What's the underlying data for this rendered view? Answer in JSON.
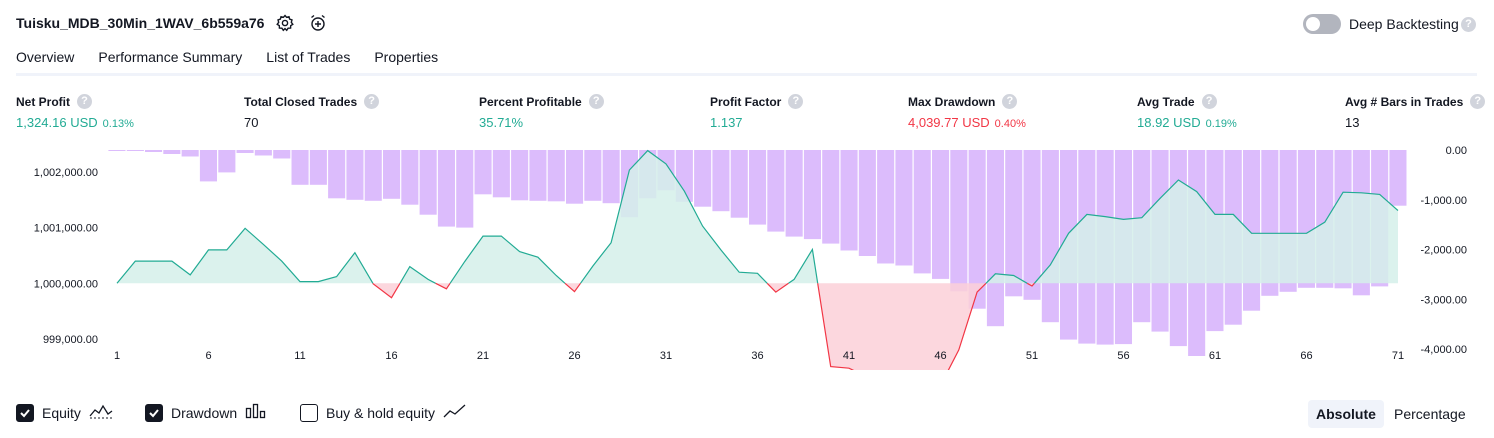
{
  "header": {
    "strategy_title": "Tuisku_MDB_30Min_1WAV_6b559a76",
    "settings_icon": "gear-icon",
    "add_alert_icon": "alarm-plus-icon",
    "deep_backtesting_label": "Deep Backtesting",
    "deep_backtesting_enabled": false,
    "help_glyph": "?"
  },
  "tabs": [
    {
      "label": "Overview",
      "active": true
    },
    {
      "label": "Performance Summary",
      "active": false
    },
    {
      "label": "List of Trades",
      "active": false
    },
    {
      "label": "Properties",
      "active": false
    }
  ],
  "metrics": [
    {
      "label": "Net Profit",
      "value": "1,324.16 USD",
      "pct": "0.13%",
      "color": "#22ab94"
    },
    {
      "label": "Total Closed Trades",
      "value": "70",
      "pct": "",
      "color": "#131722"
    },
    {
      "label": "Percent Profitable",
      "value": "35.71%",
      "pct": "",
      "color": "#22ab94"
    },
    {
      "label": "Profit Factor",
      "value": "1.137",
      "pct": "",
      "color": "#22ab94"
    },
    {
      "label": "Max Drawdown",
      "value": "4,039.77 USD",
      "pct": "0.40%",
      "color": "#f23645"
    },
    {
      "label": "Avg Trade",
      "value": "18.92 USD",
      "pct": "0.19%",
      "color": "#22ab94"
    },
    {
      "label": "Avg # Bars in Trades",
      "value": "13",
      "pct": "",
      "color": "#131722"
    }
  ],
  "chart_data": {
    "type": "line",
    "x_ticks": [
      "1",
      "6",
      "11",
      "16",
      "21",
      "26",
      "31",
      "36",
      "41",
      "46",
      "51",
      "56",
      "61",
      "66",
      "71"
    ],
    "left_axis": {
      "ticks": [
        "1,002,000.00",
        "1,001,000.00",
        "1,000,000.00",
        "999,000.00"
      ],
      "range": [
        998600,
        1002400
      ]
    },
    "right_axis": {
      "ticks": [
        "0.00",
        "-1,000.00",
        "-2,000.00",
        "-3,000.00",
        "-4,000.00"
      ],
      "range": [
        -4240,
        0
      ]
    },
    "baseline": 1000000,
    "colors": {
      "equity_up": "#22ab94",
      "equity_down": "#f23645",
      "drawdown": "#dcbcfc",
      "equity_fill_up": "#d5f0ea",
      "equity_fill_down": "#fbd0d8"
    },
    "series": [
      {
        "name": "Equity",
        "x": [
          1,
          2,
          3,
          4,
          5,
          6,
          7,
          8,
          9,
          10,
          11,
          12,
          13,
          14,
          15,
          16,
          17,
          18,
          19,
          20,
          21,
          22,
          23,
          24,
          25,
          26,
          27,
          28,
          29,
          30,
          31,
          32,
          33,
          34,
          35,
          36,
          37,
          38,
          39,
          40,
          41,
          42,
          43,
          44,
          45,
          46,
          47,
          48,
          49,
          50,
          51,
          52,
          53,
          54,
          55,
          56,
          57,
          58,
          59,
          60,
          61,
          62,
          63,
          64,
          65,
          66,
          67,
          68,
          69,
          70,
          71
        ],
        "values": [
          1000000,
          1000400,
          1000400,
          1000400,
          1000150,
          1000600,
          1000600,
          1000990,
          1000700,
          1000400,
          1000030,
          1000030,
          1000120,
          1000550,
          999990,
          999740,
          1000300,
          1000070,
          999900,
          1000390,
          1000850,
          1000850,
          1000570,
          1000470,
          1000140,
          999850,
          1000310,
          1000730,
          1002040,
          1002390,
          1002150,
          1001660,
          1001030,
          1000600,
          1000200,
          1000180,
          999840,
          1000070,
          1000610,
          998500,
          998470,
          998310,
          998030,
          997840,
          997630,
          998160,
          998800,
          999840,
          1000170,
          1000140,
          999950,
          1000330,
          1000900,
          1001240,
          1001200,
          1001150,
          1001180,
          1001530,
          1001860,
          1001650,
          1001240,
          1001240,
          1000900,
          1000900,
          1000900,
          1000900,
          1001100,
          1001640,
          1001630,
          1001600,
          1001310
        ]
      },
      {
        "name": "Drawdown",
        "values": [
          0,
          -20,
          -40,
          -80,
          -130,
          -630,
          -450,
          -60,
          -110,
          -170,
          -700,
          -700,
          -970,
          -1000,
          -1020,
          -980,
          -1100,
          -1300,
          -1540,
          -1560,
          -890,
          -950,
          -1010,
          -1020,
          -1030,
          -1080,
          -1020,
          -1070,
          -1350,
          -970,
          -810,
          -1040,
          -1140,
          -1230,
          -1360,
          -1500,
          -1640,
          -1740,
          -1790,
          -1880,
          -2020,
          -2130,
          -2280,
          -2320,
          -2480,
          -2590,
          -2840,
          -3190,
          -3540,
          -2940,
          -3010,
          -3460,
          -3810,
          -3890,
          -3910,
          -3900,
          -3460,
          -3650,
          -3940,
          -4140,
          -3640,
          -3510,
          -3230,
          -2930,
          -2850,
          -2770,
          -2770,
          -2780,
          -2920,
          -2740,
          -1120
        ]
      }
    ],
    "legend": [
      {
        "label": "Equity",
        "checked": true,
        "icon": "equity-line-icon"
      },
      {
        "label": "Drawdown",
        "checked": true,
        "icon": "drawdown-bars-icon"
      },
      {
        "label": "Buy & hold equity",
        "checked": false,
        "icon": "buy-hold-line-icon"
      }
    ]
  },
  "view_modes": [
    {
      "label": "Absolute",
      "active": true
    },
    {
      "label": "Percentage",
      "active": false
    }
  ]
}
